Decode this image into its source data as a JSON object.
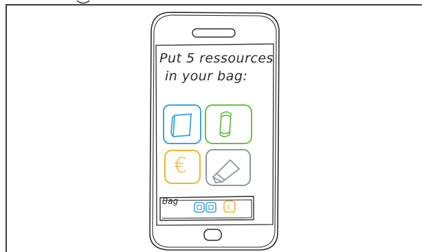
{
  "prompt": {
    "line1": "Put 5 ressources",
    "line2": "in your bag:"
  },
  "resources": [
    {
      "name": "book",
      "color": "#3aa3e0",
      "icon": "book-icon"
    },
    {
      "name": "scroll",
      "color": "#63c24a",
      "icon": "scroll-icon"
    },
    {
      "name": "euro",
      "color": "#f0b429",
      "icon": "euro-icon",
      "glyph": "€"
    },
    {
      "name": "pencil",
      "color": "#8a9aa0",
      "icon": "pencil-icon"
    }
  ],
  "bag": {
    "label": "Bag",
    "items": [
      {
        "name": "book",
        "color": "#3aa3e0"
      },
      {
        "name": "book",
        "color": "#3aa3e0"
      },
      {
        "name": "euro",
        "color": "#f0b429",
        "glyph": "€"
      }
    ]
  },
  "colors": {
    "stroke": "#2a2a2a",
    "blue": "#3aa3e0",
    "green": "#63c24a",
    "yellow": "#f0b429",
    "gray": "#8a9aa0"
  }
}
